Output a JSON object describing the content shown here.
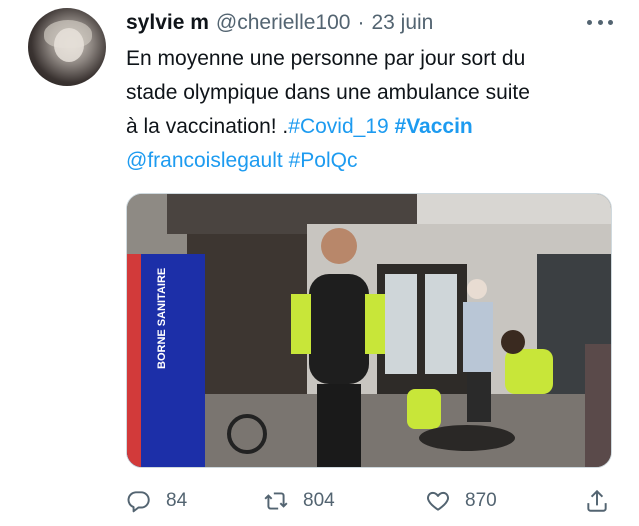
{
  "tweet": {
    "author_name": "sylvie m",
    "author_handle": "@cherielle100",
    "separator": "·",
    "date": "23 juin",
    "text_line1": "En moyenne une personne par  jour sort du",
    "text_line2": "stade olympique dans une ambulance suite",
    "text_line3_plain": "à la vaccination! .",
    "hashtag_covid": "#Covid_19",
    "hashtag_vaccin": "#Vaccin",
    "mention": "@francoislegault",
    "hashtag_polqc": "#PolQc",
    "image_sign_text": "BORNE SANITAIRE"
  },
  "actions": {
    "reply_count": "84",
    "retweet_count": "804",
    "like_count": "870"
  },
  "icons": {
    "reply": "reply-icon",
    "retweet": "retweet-icon",
    "like": "heart-icon",
    "share": "share-icon",
    "more": "more-icon"
  },
  "colors": {
    "link": "#1d9bf0",
    "muted": "#536471",
    "text": "#0f1419"
  }
}
